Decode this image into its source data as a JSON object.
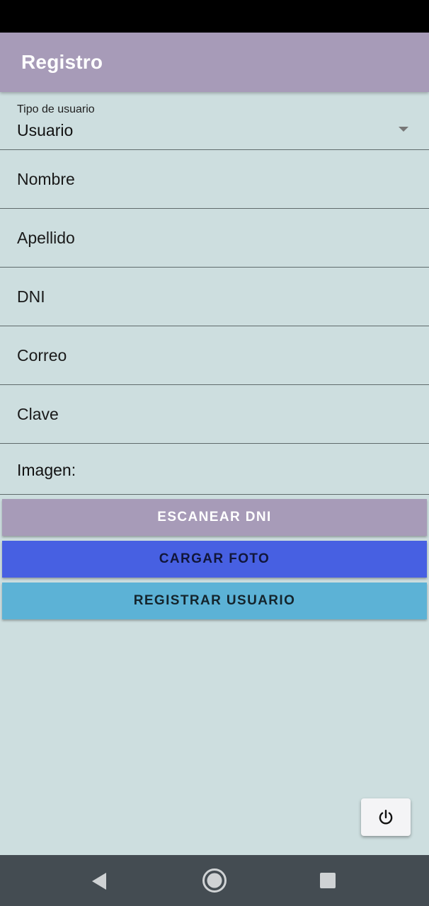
{
  "app_bar": {
    "title": "Registro"
  },
  "form": {
    "user_type": {
      "label": "Tipo de usuario",
      "value": "Usuario"
    },
    "fields": [
      {
        "placeholder": "Nombre"
      },
      {
        "placeholder": "Apellido"
      },
      {
        "placeholder": "DNI"
      },
      {
        "placeholder": "Correo"
      },
      {
        "placeholder": "Clave"
      }
    ],
    "image_label": "Imagen:"
  },
  "buttons": {
    "scan_dni": "ESCANEAR DNI",
    "upload_photo": "CARGAR FOTO",
    "register_user": "REGISTRAR USUARIO"
  },
  "icons": {
    "fab": "power-icon",
    "nav": [
      "back-icon",
      "home-icon",
      "recents-icon"
    ]
  },
  "colors": {
    "app_bar": "#a79bb8",
    "background": "#cddedf",
    "scan_button": "#a79bb8",
    "photo_button": "#4760e2",
    "register_button": "#5cb2d6",
    "nav_bar": "#444c52"
  }
}
